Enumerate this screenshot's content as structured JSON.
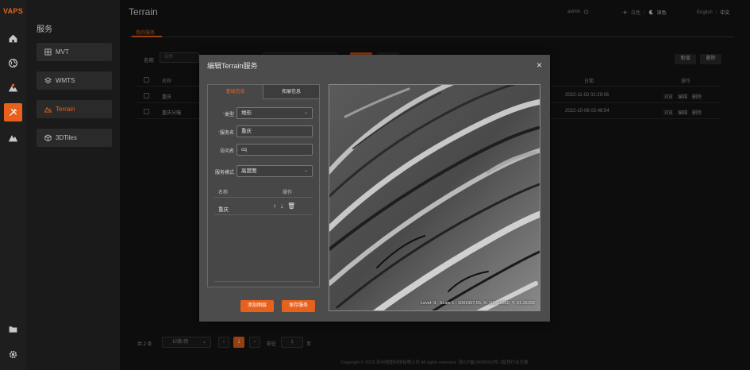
{
  "brand": "VAPS",
  "rail": {
    "icons": [
      "home-icon",
      "globe-icon",
      "terrain-mountain-icon",
      "tools-icon",
      "mountain-icon",
      "folder-icon",
      "settings-icon"
    ]
  },
  "service_sidebar": {
    "title": "服务",
    "items": [
      {
        "label": "MVT",
        "icon": "tile-icon"
      },
      {
        "label": "WMTS",
        "icon": "layers-icon"
      },
      {
        "label": "Terrain",
        "icon": "terrain-icon",
        "active": true
      },
      {
        "label": "3DTiles",
        "icon": "cube-icon"
      }
    ]
  },
  "header": {
    "title": "Terrain",
    "user": "admin",
    "theme_light": "白色",
    "theme_dark": "深色",
    "lang_en": "English",
    "lang_zh": "中文",
    "tab": "我的服务"
  },
  "list": {
    "filter_label": "名称",
    "filter_placeholder": "名称",
    "btn_new": "新增",
    "btn_delete": "删除",
    "columns": {
      "name": "名称",
      "date": "日期",
      "ops": "操作"
    },
    "rows": [
      {
        "name": "重庆",
        "date": "2022-11-02 02:29:06",
        "ops": [
          "浏览",
          "编辑",
          "删除"
        ]
      },
      {
        "name": "重庆分幅",
        "date": "2022-10-08 02:48:54",
        "ops": [
          "浏览",
          "编辑",
          "删除"
        ]
      }
    ]
  },
  "pager": {
    "total": "共 2 条",
    "page_size": "10条/页",
    "current": "1",
    "goto_label": "前往",
    "goto_value": "1",
    "page_suffix": "页"
  },
  "footer": "Copyright © 2019 苏州地图科技有限公司 All rights reserved. 苏ICP备20005933号-1智慧行业方案",
  "modal": {
    "title": "编辑Terrain服务",
    "close": "×",
    "tab_basic": "基础信息",
    "tab_ext": "拓展信息",
    "fields": {
      "type_label": "类型",
      "type_value": "地形",
      "name_label": "服务名",
      "name_value": "重庆",
      "alias_label": "访问名",
      "alias_value": "cq",
      "mode_label": "服务模式",
      "mode_value": "高度图"
    },
    "layer_table": {
      "col_name": "名称",
      "col_ops": "操作",
      "rows": [
        {
          "name": "重庆"
        }
      ]
    },
    "btn_add_layer": "添加图层",
    "btn_save": "保存服务",
    "map_status": "Level: 9 , Scale 1 : 1091957.55, X: 106.18660, Y: 31.35292"
  },
  "colors": {
    "accent": "#e8611c",
    "bg": "#141414",
    "modal": "#4c4c4c"
  }
}
